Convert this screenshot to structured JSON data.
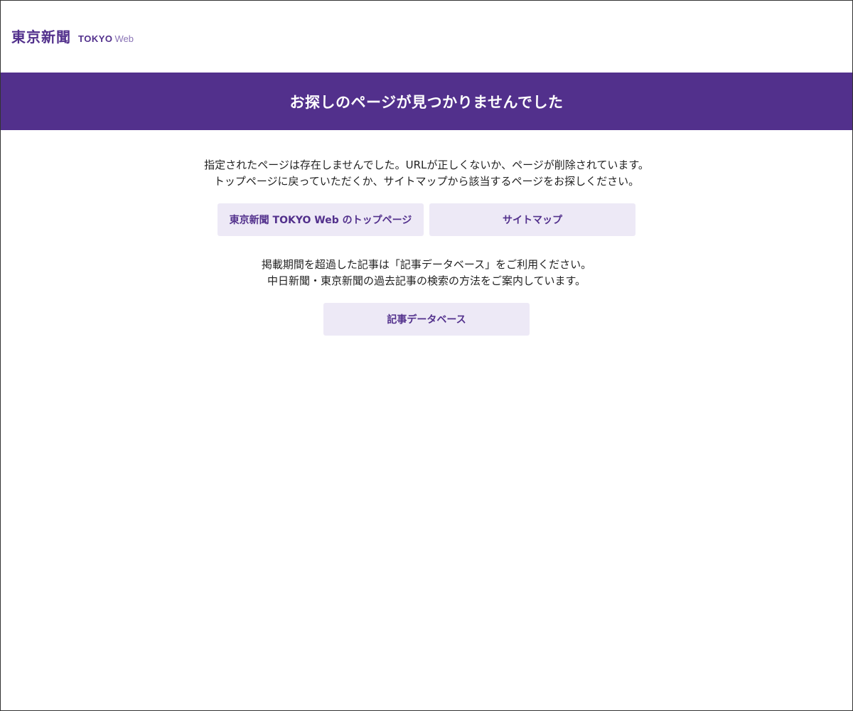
{
  "header": {
    "logo_kanji": "東京新聞",
    "logo_tokyo": "TOKYO",
    "logo_web": "Web"
  },
  "title": "お探しのページが見つかりませんでした",
  "message": {
    "line1": "指定されたページは存在しませんでした。URLが正しくないか、ページが削除されています。",
    "line2": "トップページに戻っていただくか、サイトマップから該当するページをお探しください。"
  },
  "buttons": {
    "top_page": "東京新聞 TOKYO Web のトップページ",
    "sitemap": "サイトマップ"
  },
  "archive": {
    "line1": "掲載期間を超過した記事は「記事データベース」をご利用ください。",
    "line2": "中日新聞・東京新聞の過去記事の検索の方法をご案内しています。",
    "button": "記事データベース"
  },
  "colors": {
    "brand_purple": "#52308c",
    "button_bg": "#ede9f6"
  }
}
